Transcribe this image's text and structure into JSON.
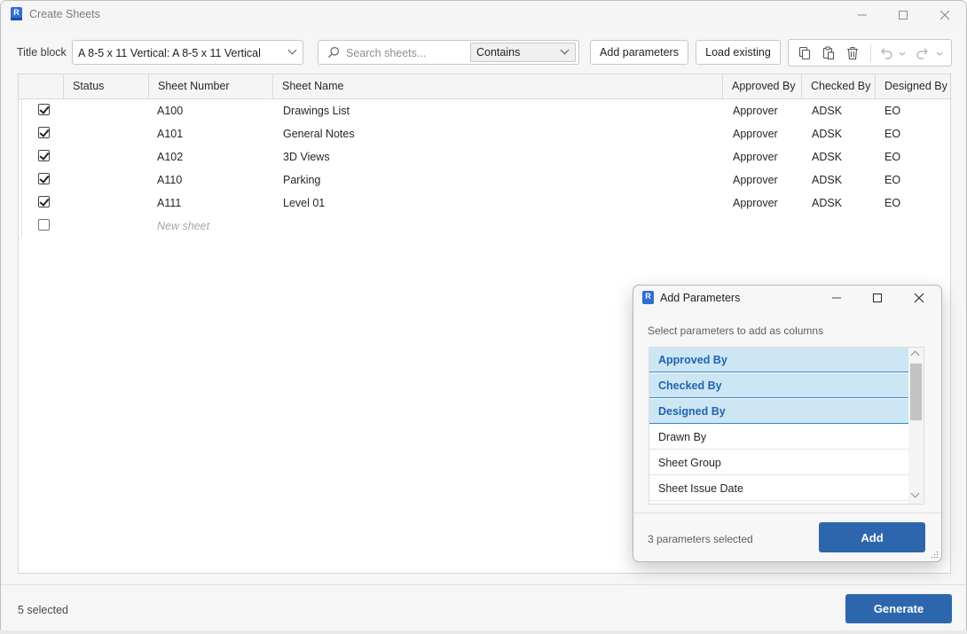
{
  "window": {
    "title": "Create Sheets",
    "logo_letter": "R"
  },
  "toolbar": {
    "title_block_label": "Title block",
    "title_block_value": "A 8-5 x 11 Vertical: A 8-5 x 11 Vertical",
    "search_placeholder": "Search sheets...",
    "search_value": "",
    "search_mode": "Contains",
    "add_parameters_label": "Add parameters",
    "load_existing_label": "Load existing",
    "icons": [
      "copy-icon",
      "paste-icon",
      "delete-icon",
      "undo-icon",
      "undo-dropdown-icon",
      "redo-icon",
      "redo-dropdown-icon"
    ]
  },
  "grid": {
    "columns": [
      "Status",
      "Sheet Number",
      "Sheet Name",
      "Approved By",
      "Checked By",
      "Designed By"
    ],
    "rows": [
      {
        "checked": true,
        "status": "",
        "number": "A100",
        "name": "Drawings List",
        "approved_by": "Approver",
        "checked_by": "ADSK",
        "designed_by": "EO"
      },
      {
        "checked": true,
        "status": "",
        "number": "A101",
        "name": "General Notes",
        "approved_by": "Approver",
        "checked_by": "ADSK",
        "designed_by": "EO"
      },
      {
        "checked": true,
        "status": "",
        "number": "A102",
        "name": "3D Views",
        "approved_by": "Approver",
        "checked_by": "ADSK",
        "designed_by": "EO"
      },
      {
        "checked": true,
        "status": "",
        "number": "A110",
        "name": "Parking",
        "approved_by": "Approver",
        "checked_by": "ADSK",
        "designed_by": "EO"
      },
      {
        "checked": true,
        "status": "",
        "number": "A111",
        "name": "Level 01",
        "approved_by": "Approver",
        "checked_by": "ADSK",
        "designed_by": "EO"
      }
    ],
    "new_row_placeholder": "New sheet"
  },
  "footer": {
    "selection_text": "5 selected",
    "generate_label": "Generate"
  },
  "dialog": {
    "title": "Add Parameters",
    "logo_letter": "R",
    "hint": "Select parameters to add as columns",
    "parameters": [
      {
        "label": "Approved By",
        "selected": true
      },
      {
        "label": "Checked By",
        "selected": true
      },
      {
        "label": "Designed By",
        "selected": true
      },
      {
        "label": "Drawn By",
        "selected": false
      },
      {
        "label": "Sheet Group",
        "selected": false
      },
      {
        "label": "Sheet Issue Date",
        "selected": false
      }
    ],
    "count_text": "3 parameters selected",
    "add_label": "Add"
  },
  "colors": {
    "accent": "#2d66ad",
    "selection_bg": "#cde6f4",
    "selection_text": "#1e64ae",
    "logo_blue": "#2d6fd2"
  }
}
